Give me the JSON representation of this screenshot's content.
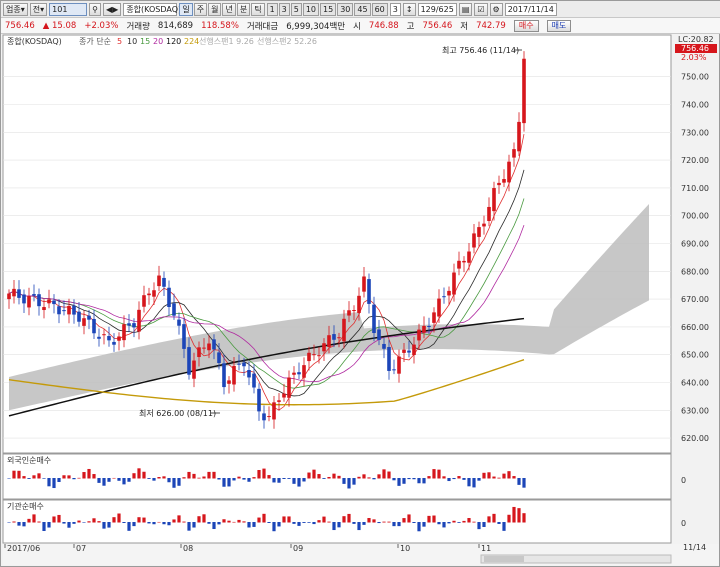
{
  "toolbar": {
    "market_select": "업종",
    "type_select": "전",
    "code_input": "101",
    "index_name": "종합(KOSDAQ)",
    "period_buttons": [
      "일",
      "주",
      "월",
      "년",
      "분",
      "틱"
    ],
    "active_period": "일",
    "interval_buttons": [
      "1",
      "3",
      "5",
      "10",
      "15",
      "30",
      "45",
      "60"
    ],
    "custom_interval": "3",
    "page_counter": "129/625",
    "date": "2017/11/14"
  },
  "quote_bar": {
    "price": "756.46",
    "change": "▲ 15.08",
    "change_pct": "+2.03%",
    "volume_label": "거래량",
    "volume": "814,689",
    "volume_ratio": "118.58%",
    "amount_label": "거래대금",
    "amount": "6,999,304백만",
    "open_label": "시",
    "open": "746.88",
    "high_label": "고",
    "high": "756.46",
    "low_label": "저",
    "low": "742.79",
    "buy_label": "매수",
    "sell_label": "매도"
  },
  "chart_data": {
    "type": "candlestick",
    "main_panel": {
      "legend": "종합(KOSDAQ)",
      "ma_label": "종가 단순",
      "ma_periods": [
        "5",
        "10",
        "15",
        "20",
        "120",
        "224"
      ],
      "ma_colors": [
        "#e03030",
        "#2a2a2a",
        "#4a9a40",
        "#b02aa0",
        "#111111",
        "#c49a0a"
      ],
      "span_labels": [
        "선행스팬1 9.26",
        "선행스팬2 52.26"
      ],
      "y_ticks": [
        620,
        630,
        640,
        650,
        660,
        670,
        680,
        690,
        700,
        710,
        720,
        730,
        740,
        750
      ],
      "ylim": [
        615,
        765
      ],
      "lc_label": "LC:20.82",
      "price_tag": "756.46",
      "pct_tag": "2.03%",
      "high_annotation": "최고 756.46 (11/14)",
      "low_annotation": "최저 626.00 (08/11)"
    },
    "foreign_panel": {
      "title": "외국인순매수",
      "zero_label": "0"
    },
    "institution_panel": {
      "title": "기관순매수",
      "zero_label": "0"
    },
    "x_labels": [
      "2017/06",
      "07",
      "08",
      "09",
      "10",
      "11"
    ],
    "x_end_label": "11/14",
    "colors": {
      "up": "#d6161c",
      "down": "#1c45b8",
      "cloud": "#bdbdbd"
    }
  }
}
